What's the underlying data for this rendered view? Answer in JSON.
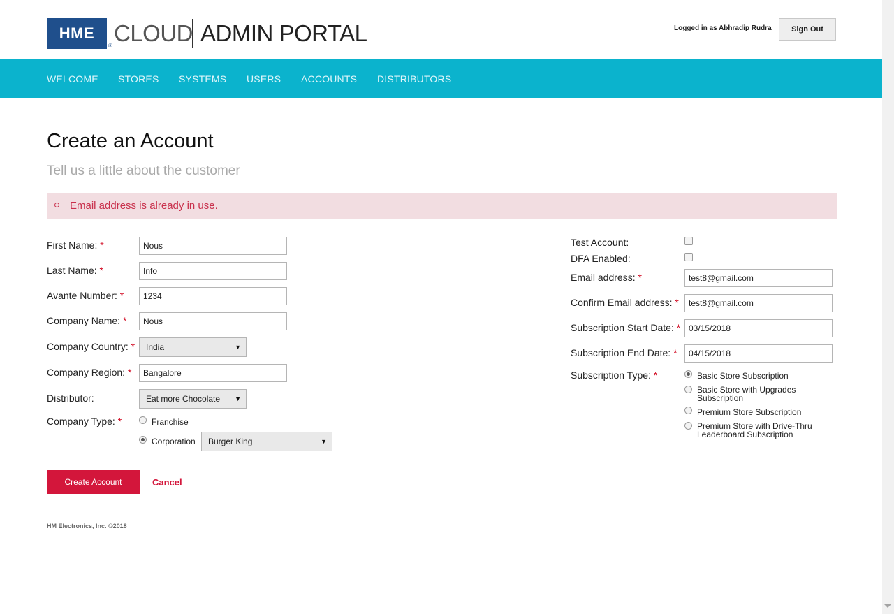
{
  "header": {
    "logo": "HME",
    "logo_reg": "®",
    "cloud": "CLOUD",
    "portal": "ADMIN PORTAL",
    "logged_in": "Logged in as Abhradip Rudra",
    "sign_out": "Sign Out"
  },
  "nav": {
    "items": [
      "WELCOME",
      "STORES",
      "SYSTEMS",
      "USERS",
      "ACCOUNTS",
      "DISTRIBUTORS"
    ]
  },
  "page": {
    "title": "Create an Account",
    "subtitle": "Tell us a little about the customer"
  },
  "error": {
    "message": "Email address is already in use."
  },
  "form_left": {
    "first_name": {
      "label": "First Name:",
      "value": "Nous"
    },
    "last_name": {
      "label": "Last Name:",
      "value": "Info"
    },
    "avante_number": {
      "label": "Avante Number:",
      "value": "1234"
    },
    "company_name": {
      "label": "Company Name:",
      "value": "Nous"
    },
    "company_country": {
      "label": "Company Country:",
      "value": "India"
    },
    "company_region": {
      "label": "Company Region:",
      "value": "Bangalore"
    },
    "distributor": {
      "label": "Distributor:",
      "value": "Eat more Chocolate"
    },
    "company_type": {
      "label": "Company Type:",
      "franchise": "Franchise",
      "corporation": "Corporation",
      "brand": "Burger King",
      "selected": "Corporation"
    }
  },
  "form_right": {
    "test_account": {
      "label": "Test Account:",
      "checked": false
    },
    "dfa_enabled": {
      "label": "DFA Enabled:",
      "checked": false
    },
    "email": {
      "label": "Email address:",
      "value": "test8@gmail.com"
    },
    "confirm_email": {
      "label": "Confirm Email address:",
      "value": "test8@gmail.com"
    },
    "sub_start": {
      "label": "Subscription Start Date:",
      "value": "03/15/2018"
    },
    "sub_end": {
      "label": "Subscription End Date:",
      "value": "04/15/2018"
    },
    "sub_type": {
      "label": "Subscription Type:",
      "options": [
        {
          "line1": "Basic Store Subscription",
          "line2": ""
        },
        {
          "line1": "Basic Store with Upgrades",
          "line2": "Subscription"
        },
        {
          "line1": "Premium Store Subscription",
          "line2": ""
        },
        {
          "line1": "Premium Store with Drive-Thru",
          "line2": "Leaderboard Subscription"
        }
      ],
      "selected": "Basic Store Subscription"
    }
  },
  "actions": {
    "create": "Create Account",
    "cancel": "Cancel"
  },
  "footer": {
    "text": "HM Electronics, Inc. ©2018"
  },
  "required_mark": "*",
  "select_arrow": "▼",
  "colors": {
    "brand_blue": "#1f4f8c",
    "nav_teal": "#0bb3cd",
    "accent_red": "#d3163b",
    "error_bg": "#f2dde1"
  }
}
